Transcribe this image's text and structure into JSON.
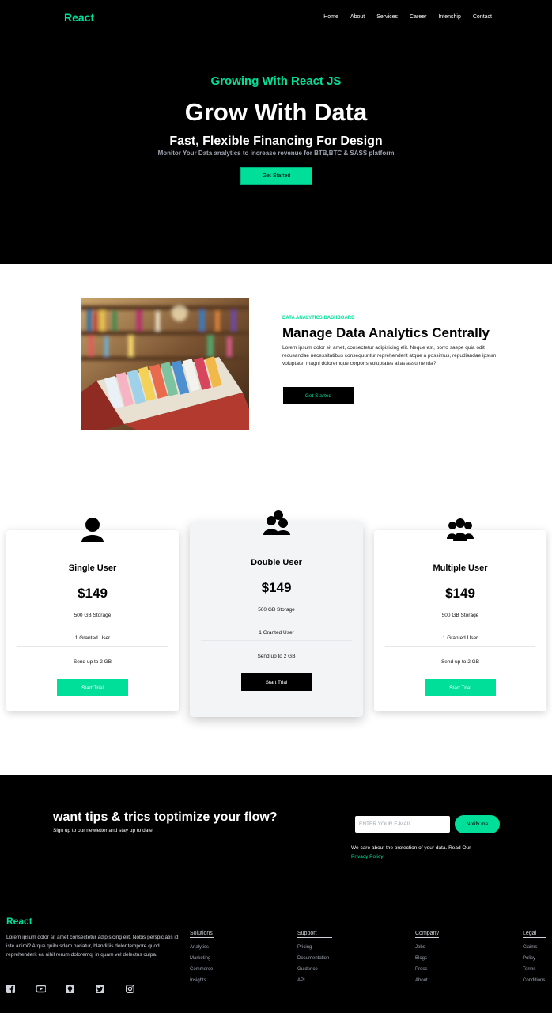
{
  "nav": {
    "logo": "React",
    "items": [
      "Home",
      "About",
      "Services",
      "Career",
      "Intenship",
      "Contact"
    ]
  },
  "hero": {
    "kicker": "Growing With React JS",
    "title": "Grow With Data",
    "subtitle": "Fast, Flexible Financing For Design",
    "description": "Monitor Your Data analytics to increase revenue for BTB,BTC & SASS platform",
    "cta": "Get Started"
  },
  "analytics": {
    "tag": "DATA ANALYTICS DASHBOARD",
    "title": "Manage Data Analytics Centrally",
    "paragraph": "Lorem ipsum dolor sit amet, consectetur adipisicing elit. Neque est, porro saepe quia odit recusandae necessitatibus consequuntur reprehenderit atque a possimus, repudiandae ipsum voluptate, magni doloremque corporis voluptates alias assumenda?",
    "button": "Get Started"
  },
  "pricing": [
    {
      "name": "Single User",
      "price": "$149",
      "storage": "500 GB Storage",
      "users": "1 Granted User",
      "send": "Send up to 2 GB",
      "button": "Start Trial"
    },
    {
      "name": "Double User",
      "price": "$149",
      "storage": "500 GB Storage",
      "users": "1 Granted User",
      "send": "Send up to 2 GB",
      "button": "Start Trial"
    },
    {
      "name": "Multiple User",
      "price": "$149",
      "storage": "500 GB Storage",
      "users": "1 Granted User",
      "send": "Send up to 2 GB",
      "button": "Start Trial"
    }
  ],
  "newsletter": {
    "heading": "want tips & trics toptimize your flow?",
    "sub": "Sign up to our newletter and stay up to date.",
    "placeholder": "ENTER YOUR E-MAIL",
    "button": "Notify me",
    "care": "We care about the protection of your data. Read Our",
    "link": "Privacy Policy"
  },
  "footer": {
    "logo": "React",
    "about": "Lorem ipsum dolor sit amet consectetur adipisicing elit. Nobis perspiciatis id iste animi? Atque quibusdam pariatur, blanditiis dolor tempore quod reprehenderit ea nihil rerum doloremq, in quam vel delectus culpa.",
    "columns": [
      {
        "title": "Solutions",
        "items": [
          "Analytics",
          "Marketing",
          "Commerce",
          "Insights"
        ]
      },
      {
        "title": "Support",
        "items": [
          "Pricing",
          "Documentation",
          "Guidence",
          "API"
        ]
      },
      {
        "title": "Company",
        "items": [
          "Jobs",
          "Blogs",
          "Press",
          "About"
        ]
      },
      {
        "title": "Legal",
        "items": [
          "Claims",
          "Policy",
          "Terms",
          "Conditions"
        ]
      }
    ],
    "social_icons": [
      "facebook-icon",
      "youtube-icon",
      "github-icon",
      "twitter-icon",
      "instagram-icon"
    ]
  },
  "colors": {
    "accent": "#00df9a",
    "dark": "#000000",
    "light": "#ffffff",
    "card_mid": "#f3f4f6"
  }
}
